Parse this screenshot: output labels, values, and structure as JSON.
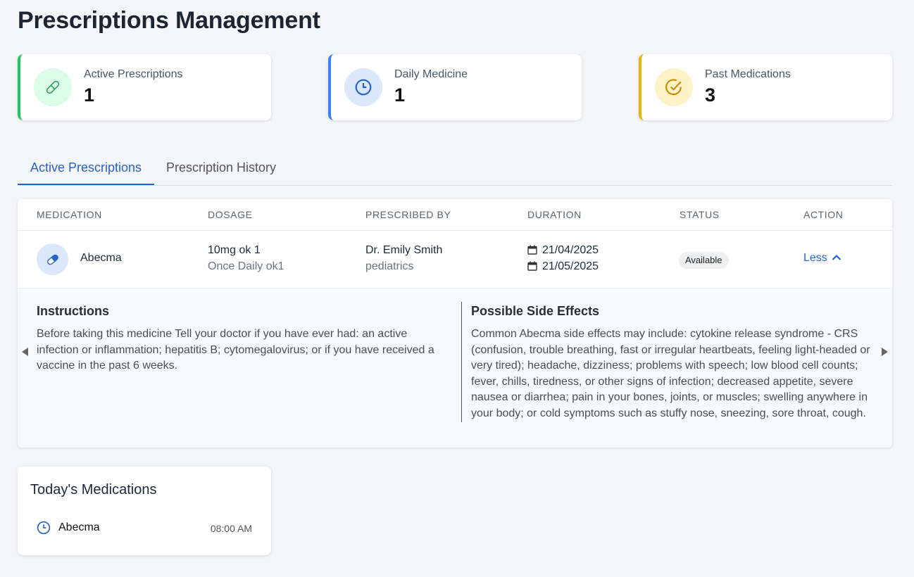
{
  "page": {
    "title": "Prescriptions Management"
  },
  "stats": [
    {
      "label": "Active Prescriptions",
      "value": "1",
      "icon": "pill-icon",
      "color": "#22c55e"
    },
    {
      "label": "Daily Medicine",
      "value": "1",
      "icon": "clock-icon",
      "color": "#3b82f6"
    },
    {
      "label": "Past Medications",
      "value": "3",
      "icon": "check-circle-icon",
      "color": "#eab308"
    }
  ],
  "tabs": [
    {
      "label": "Active Prescriptions",
      "active": true
    },
    {
      "label": "Prescription History",
      "active": false
    }
  ],
  "table": {
    "headers": [
      "Medication",
      "Dosage",
      "Prescribed By",
      "Duration",
      "Status",
      "Action"
    ],
    "rows": [
      {
        "medication": "Abecma",
        "dosage": "10mg ok 1",
        "frequency": "Once Daily ok1",
        "doctor": "Dr. Emily Smith",
        "specialty": "pediatrics",
        "start_date": "21/04/2025",
        "end_date": "21/05/2025",
        "status": "Available",
        "action": "Less"
      }
    ],
    "details": {
      "instructions_title": "Instructions",
      "instructions": "Before taking this medicine Tell your doctor if you have ever had: an active infection or inflammation; hepatitis B; cytomegalovirus; or if you have received a vaccine in the past 6 weeks.",
      "side_effects_title": "Possible Side Effects",
      "side_effects": "Common Abecma side effects may include: cytokine release syndrome - CRS (confusion, trouble breathing, fast or irregular heartbeats, feeling light-headed or very tired); headache, dizziness; problems with speech; low blood cell counts; fever, chills, tiredness, or other signs of infection; decreased appetite, severe nausea or diarrhea; pain in your bones, joints, or muscles; swelling anywhere in your body; or cold symptoms such as stuffy nose, sneezing, sore throat, cough."
    }
  },
  "today": {
    "title": "Today's Medications",
    "items": [
      {
        "name": "Abecma",
        "time": "08:00 AM"
      }
    ]
  },
  "colors": {
    "accent": "#2563c9",
    "background": "#f4f6f9"
  }
}
